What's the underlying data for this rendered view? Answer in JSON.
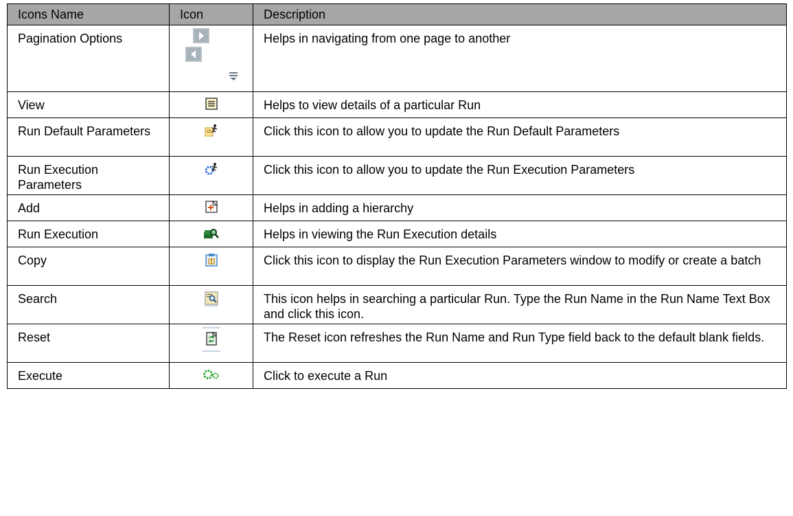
{
  "headers": [
    "Icons Name",
    "Icon",
    "Description"
  ],
  "rows": [
    {
      "name": "Pagination Options",
      "icons": [
        "next-page-icon",
        "previous-page-icon",
        "rows-per-page-icon"
      ],
      "description": "Helps in navigating from one page to another"
    },
    {
      "name": "View",
      "icons": [
        "view-icon"
      ],
      "description": "Helps to view details of a particular Run"
    },
    {
      "name": "Run Default Parameters",
      "icons": [
        "run-default-parameters-icon"
      ],
      "description": "Click this icon to allow you to update the Run Default Parameters"
    },
    {
      "name": "Run Execution Parameters",
      "icons": [
        "run-execution-parameters-icon"
      ],
      "description": "Click this icon to allow you to update the Run Execution Parameters"
    },
    {
      "name": "Add",
      "icons": [
        "add-icon"
      ],
      "description": "Helps in adding a hierarchy"
    },
    {
      "name": "Run Execution",
      "icons": [
        "run-execution-icon"
      ],
      "description": "Helps in viewing the Run Execution details"
    },
    {
      "name": "Copy",
      "icons": [
        "copy-icon"
      ],
      "description": "Click this icon to display the Run Execution Parameters window to modify or create a batch"
    },
    {
      "name": "Search",
      "icons": [
        "search-icon"
      ],
      "description": "This icon helps in searching a particular Run. Type the Run Name in the Run Name Text Box and click this icon."
    },
    {
      "name": "Reset",
      "icons": [
        "reset-icon"
      ],
      "description": "The Reset icon refreshes the Run Name and Run Type field back to the default blank fields."
    },
    {
      "name": "Execute",
      "icons": [
        "execute-icon"
      ],
      "description": "Click to execute a Run"
    }
  ]
}
